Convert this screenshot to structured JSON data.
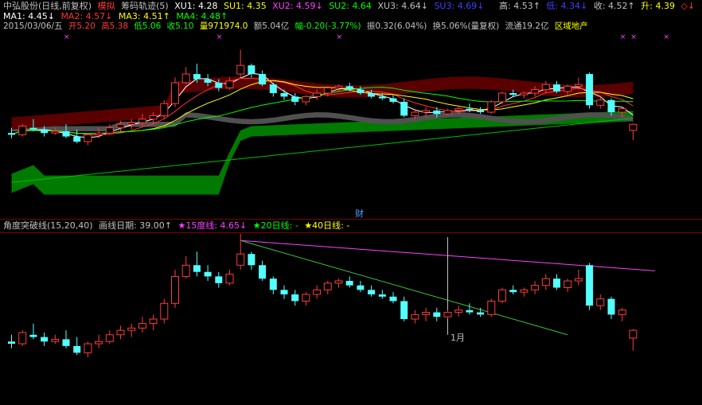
{
  "colors": {
    "bg": "#000000",
    "up": "#ff3b3b",
    "down": "#54ffff",
    "ma1": "#ffffff",
    "ma2": "#ff3232",
    "ma3": "#ffff00",
    "ma4": "#00ff00",
    "magenta": "#ff40ff",
    "label": "#c0c0c0"
  },
  "header": {
    "stock": "中弘股份(日线,前复权)",
    "mode": "模拟",
    "indicator": "筹码轨迹(5)",
    "xu1": "XU1: 4.28",
    "su1": "SU1: 4.35",
    "xu2": "XU2: 4.59↓",
    "su2": "SU2: 4.64",
    "xu3": "XU3: 4.64↓",
    "su3": "SU3: 4.69↓",
    "high": "高: 4.53↑",
    "low": "低: 4.34↓",
    "close": "收: 4.52↑",
    "up": "升: 4.39",
    "diamond": "◇↓"
  },
  "ma": {
    "ma1": "MA1: 4.45↓",
    "ma2": "MA2: 4.57↓",
    "ma3": "MA3: 4.51↑",
    "ma4": "MA4: 4.48↑"
  },
  "quote": {
    "date": "2015/03/06/五",
    "open": "开5.20",
    "high": "高5.38",
    "low": "低5.06",
    "close": "收5.10",
    "volume": "量971974.0",
    "amount": "额5.04亿",
    "change": "幅-0.20(-3.77%)",
    "amplitude": "振0.32(6.04%)",
    "turnover": "换5.06%(量复权)",
    "float": "流通19.2亿",
    "sector": "区域地产"
  },
  "lower": {
    "title": "角度突破线(15,20,40)",
    "date_line": "画线日期: 39.00↑",
    "line15": "★15度线: 4.65↓",
    "line20": "★20日线: -",
    "line40": "★40日线: -"
  },
  "marks": {
    "cai": "财",
    "month": "1月"
  },
  "chart_data": {
    "type": "candlestick",
    "ohlc": [
      [
        4.42,
        4.48,
        4.36,
        4.4
      ],
      [
        4.4,
        4.52,
        4.38,
        4.5
      ],
      [
        4.48,
        4.58,
        4.44,
        4.46
      ],
      [
        4.46,
        4.5,
        4.38,
        4.42
      ],
      [
        4.42,
        4.48,
        4.4,
        4.44
      ],
      [
        4.44,
        4.52,
        4.36,
        4.38
      ],
      [
        4.38,
        4.46,
        4.3,
        4.32
      ],
      [
        4.32,
        4.42,
        4.28,
        4.4
      ],
      [
        4.4,
        4.48,
        4.36,
        4.42
      ],
      [
        4.42,
        4.52,
        4.4,
        4.48
      ],
      [
        4.48,
        4.56,
        4.44,
        4.52
      ],
      [
        4.52,
        4.58,
        4.46,
        4.54
      ],
      [
        4.54,
        4.64,
        4.5,
        4.58
      ],
      [
        4.58,
        4.66,
        4.52,
        4.62
      ],
      [
        4.62,
        4.8,
        4.58,
        4.76
      ],
      [
        4.76,
        5.06,
        4.72,
        5.0
      ],
      [
        5.0,
        5.18,
        4.98,
        5.1
      ],
      [
        5.1,
        5.22,
        5.0,
        5.04
      ],
      [
        5.04,
        5.1,
        4.96,
        5.0
      ],
      [
        5.0,
        5.04,
        4.9,
        4.94
      ],
      [
        4.94,
        5.06,
        4.92,
        5.02
      ],
      [
        5.1,
        5.38,
        5.06,
        5.2
      ],
      [
        5.2,
        5.22,
        5.06,
        5.1
      ],
      [
        5.1,
        5.14,
        4.96,
        4.98
      ],
      [
        4.98,
        5.0,
        4.84,
        4.88
      ],
      [
        4.88,
        4.92,
        4.8,
        4.84
      ],
      [
        4.84,
        4.88,
        4.74,
        4.78
      ],
      [
        4.78,
        4.86,
        4.74,
        4.84
      ],
      [
        4.84,
        4.92,
        4.8,
        4.88
      ],
      [
        4.88,
        4.96,
        4.84,
        4.94
      ],
      [
        4.94,
        4.98,
        4.9,
        4.96
      ],
      [
        4.96,
        5.0,
        4.9,
        4.92
      ],
      [
        4.92,
        4.96,
        4.86,
        4.88
      ],
      [
        4.88,
        4.92,
        4.82,
        4.84
      ],
      [
        4.84,
        4.88,
        4.8,
        4.82
      ],
      [
        4.82,
        4.86,
        4.76,
        4.78
      ],
      [
        4.78,
        4.82,
        4.6,
        4.62
      ],
      [
        4.62,
        4.7,
        4.58,
        4.66
      ],
      [
        4.66,
        4.72,
        4.6,
        4.68
      ],
      [
        4.68,
        4.72,
        4.6,
        4.64
      ],
      [
        4.64,
        4.7,
        4.62,
        4.68
      ],
      [
        4.68,
        4.74,
        4.64,
        4.7
      ],
      [
        4.7,
        4.76,
        4.66,
        4.68
      ],
      [
        4.68,
        4.72,
        4.64,
        4.66
      ],
      [
        4.66,
        4.8,
        4.64,
        4.78
      ],
      [
        4.78,
        4.9,
        4.76,
        4.88
      ],
      [
        4.88,
        4.92,
        4.84,
        4.86
      ],
      [
        4.86,
        4.9,
        4.82,
        4.88
      ],
      [
        4.88,
        4.96,
        4.84,
        4.92
      ],
      [
        4.92,
        5.02,
        4.88,
        4.98
      ],
      [
        4.98,
        5.02,
        4.88,
        4.9
      ],
      [
        4.9,
        4.98,
        4.86,
        4.96
      ],
      [
        4.96,
        5.06,
        4.92,
        4.98
      ],
      [
        5.1,
        5.12,
        4.7,
        4.74
      ],
      [
        4.74,
        4.84,
        4.7,
        4.8
      ],
      [
        4.8,
        4.82,
        4.62,
        4.66
      ],
      [
        4.66,
        4.72,
        4.6,
        4.7
      ],
      [
        4.45,
        4.53,
        4.34,
        4.52
      ]
    ]
  }
}
